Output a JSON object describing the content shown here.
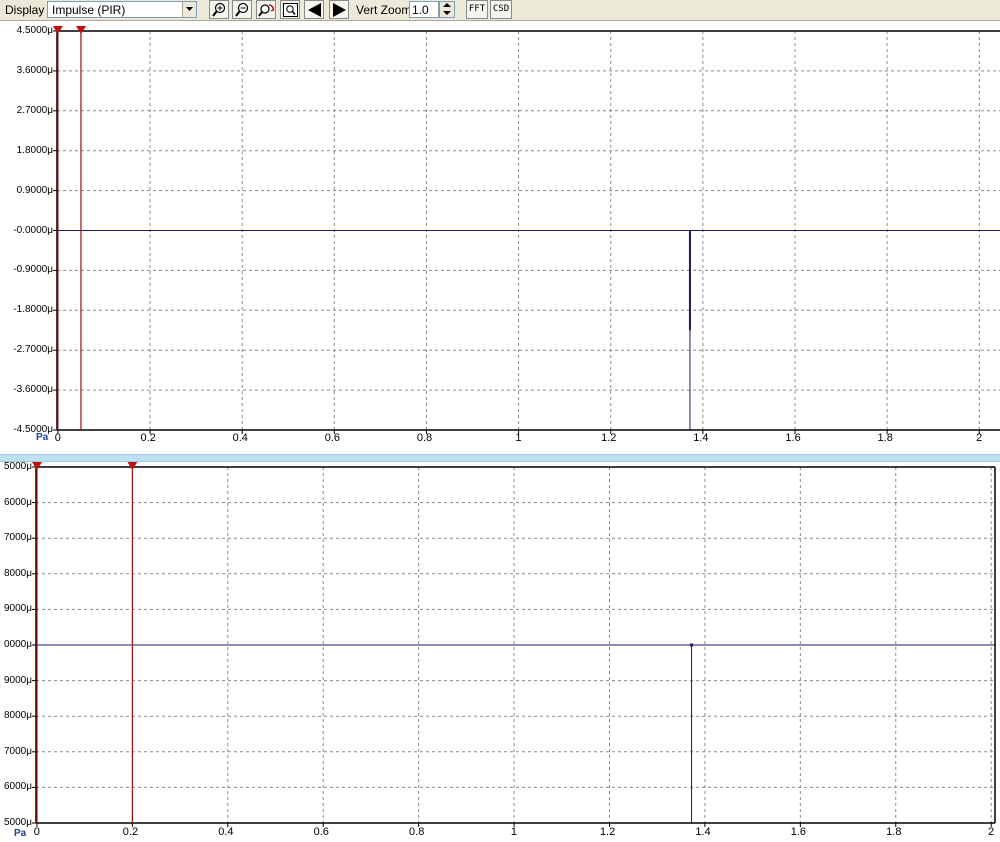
{
  "toolbar": {
    "display_label": "Display",
    "display_value": "Impulse (PIR)",
    "vert_zoom_label": "Vert Zoom",
    "vert_zoom_value": "1.0",
    "fft_label": "FFT",
    "csd_label": "CSD"
  },
  "panels": [
    {
      "unit": "Pa",
      "y_ticks": [
        "4.5000μ",
        "3.6000μ",
        "2.7000μ",
        "1.8000μ",
        "0.9000μ",
        "-0.0000μ",
        "-0.9000μ",
        "-1.8000μ",
        "-2.7000μ",
        "-3.6000μ",
        "-4.5000μ"
      ],
      "x_ticks": [
        "0",
        "0.2",
        "0.4",
        "0.6",
        "0.8",
        "1",
        "1.2",
        "1.4",
        "1.6",
        "1.8",
        "2"
      ],
      "chart_data": {
        "type": "line",
        "xlim": [
          -0.002,
          2.045
        ],
        "ylim": [
          -4.5,
          4.5
        ],
        "y_unit": "μPa",
        "markers_x": [
          0.0,
          0.05
        ],
        "impulse": {
          "x": 1.372,
          "y_min": -4.5,
          "y_max": 0.0,
          "y_thick_to": -2.25
        },
        "baseline_y": 0.0,
        "grid": true
      }
    },
    {
      "unit": "Pa",
      "y_ticks": [
        "5000μ",
        "6000μ",
        "7000μ",
        "8000μ",
        "9000μ",
        "0000μ",
        "9000μ",
        "8000μ",
        "7000μ",
        "6000μ",
        "5000μ"
      ],
      "x_ticks": [
        "0",
        "0.2",
        "0.4",
        "0.6",
        "0.8",
        "1",
        "1.2",
        "1.4",
        "1.6",
        "1.8",
        "2"
      ],
      "chart_data": {
        "type": "line",
        "xlim": [
          -0.002,
          2.008
        ],
        "ylim": [
          -5,
          5
        ],
        "markers_x": [
          0.0,
          0.2
        ],
        "impulse": {
          "x": 1.372,
          "y_min": -5,
          "y_max": 0.0,
          "y_thick_to": 0.0
        },
        "baseline_y": 0.0,
        "grid": true
      }
    }
  ]
}
